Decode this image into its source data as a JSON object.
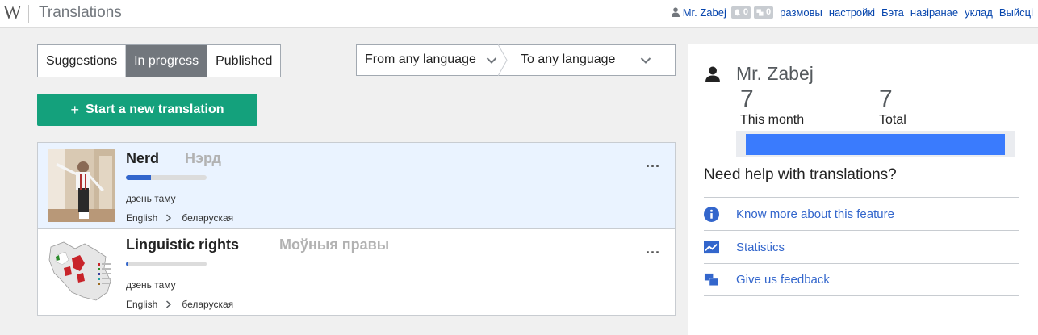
{
  "app": {
    "logo": "W",
    "title": "Translations"
  },
  "usermenu": {
    "username": "Mr. Zabej",
    "alerts_count": "0",
    "notices_count": "0",
    "links": [
      "размовы",
      "настройкі",
      "Бэта",
      "назіранае",
      "уклад",
      "Выйсці"
    ]
  },
  "tabs": [
    {
      "label": "Suggestions",
      "active": false
    },
    {
      "label": "In progress",
      "active": true
    },
    {
      "label": "Published",
      "active": false
    }
  ],
  "language_filter": {
    "from": "From any language",
    "to": "To any language"
  },
  "start_button": {
    "icon": "+",
    "label": "Start a new translation"
  },
  "translations": [
    {
      "title": "Nerd",
      "target_title": "Нэрд",
      "progress": 0.31,
      "time": "дзень таму",
      "source_language": "English",
      "target_language": "беларуская",
      "more": "..."
    },
    {
      "title": "Linguistic rights",
      "target_title": "Моўныя правы",
      "progress": 0.01,
      "time": "дзень таму",
      "source_language": "English",
      "target_language": "беларуская",
      "more": "..."
    }
  ],
  "sidebar": {
    "username": "Mr. Zabej",
    "stats": [
      {
        "value": "7",
        "label": "This month"
      },
      {
        "value": "7",
        "label": "Total"
      }
    ],
    "activity_fill": 1.0,
    "help_heading": "Need help with translations?",
    "help_links": [
      {
        "icon": "info-icon",
        "label": "Know more about this feature"
      },
      {
        "icon": "statistics-icon",
        "label": "Statistics"
      },
      {
        "icon": "feedback-icon",
        "label": "Give us feedback"
      }
    ]
  },
  "colors": {
    "accent_green": "#14a17c",
    "link_blue": "#36c",
    "active_tab": "#72777d",
    "chart_bar": "#3a7bfd",
    "selected_row": "#eaf3ff"
  }
}
